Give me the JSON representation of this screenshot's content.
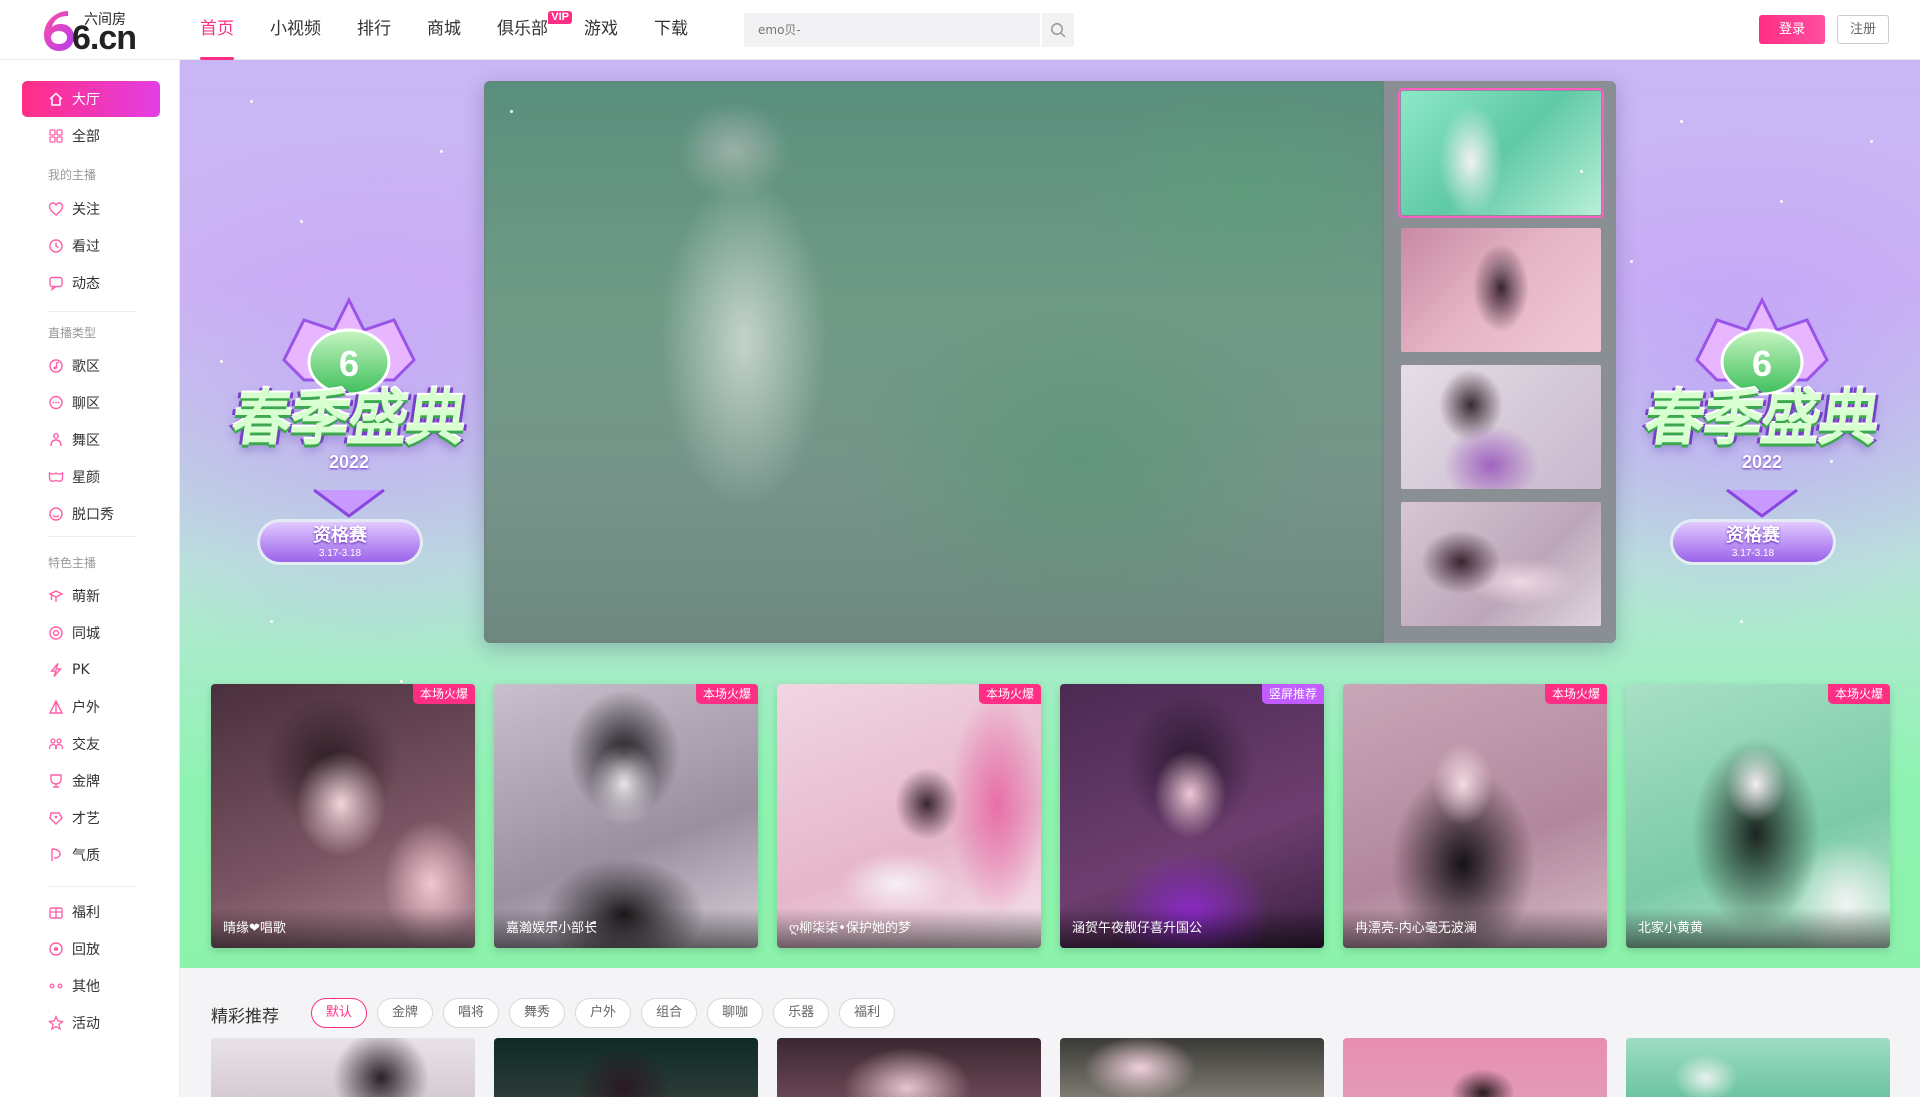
{
  "header": {
    "logo": {
      "brand": "6.cn",
      "cn_name": "六间房"
    },
    "nav": [
      {
        "label": "首页",
        "active": true
      },
      {
        "label": "小视频"
      },
      {
        "label": "排行"
      },
      {
        "label": "商城"
      },
      {
        "label": "俱乐部",
        "badge": "VIP"
      },
      {
        "label": "游戏"
      },
      {
        "label": "下载"
      }
    ],
    "search": {
      "placeholder": "emo贝-"
    },
    "login_label": "登录",
    "register_label": "注册"
  },
  "sidebar": {
    "top": [
      {
        "label": "大厅",
        "icon": "home-icon",
        "active": true
      },
      {
        "label": "全部",
        "icon": "grid-icon"
      }
    ],
    "my_anchors": {
      "title": "我的主播",
      "items": [
        {
          "label": "关注",
          "icon": "heart-icon"
        },
        {
          "label": "看过",
          "icon": "clock-icon"
        },
        {
          "label": "动态",
          "icon": "chat-icon"
        }
      ]
    },
    "live_types": {
      "title": "直播类型",
      "items": [
        {
          "label": "歌区",
          "icon": "music-icon"
        },
        {
          "label": "聊区",
          "icon": "bubble-icon"
        },
        {
          "label": "舞区",
          "icon": "dance-icon"
        },
        {
          "label": "星颜",
          "icon": "mask-icon"
        },
        {
          "label": "脱口秀",
          "icon": "mic-icon"
        }
      ]
    },
    "featured": {
      "title": "特色主播",
      "items": [
        {
          "label": "萌新",
          "icon": "sprout-icon"
        },
        {
          "label": "同城",
          "icon": "location-icon"
        },
        {
          "label": "PK",
          "icon": "lightning-icon"
        },
        {
          "label": "户外",
          "icon": "tent-icon"
        },
        {
          "label": "交友",
          "icon": "friends-icon"
        },
        {
          "label": "金牌",
          "icon": "medal-icon"
        },
        {
          "label": "才艺",
          "icon": "talent-icon"
        },
        {
          "label": "气质",
          "icon": "elegant-icon"
        }
      ]
    },
    "bottom": [
      {
        "label": "福利",
        "icon": "gift-icon"
      },
      {
        "label": "回放",
        "icon": "replay-icon"
      },
      {
        "label": "其他",
        "icon": "more-icon"
      },
      {
        "label": "活动",
        "icon": "star-icon"
      }
    ]
  },
  "banner": {
    "event_title": "春季盛典",
    "event_year": "2022",
    "stage_label": "资格赛",
    "stage_dates": "3.17-3.18",
    "hot_cards": [
      {
        "name": "晴缘❤唱歌",
        "tag": "本场火爆",
        "tag_type": "hot"
      },
      {
        "name": "嘉瀚娱乐ื小部长ื",
        "tag": "本场火爆",
        "tag_type": "hot"
      },
      {
        "name": "ღ柳柒柒•保护她的梦",
        "tag": "本场火爆",
        "tag_type": "hot"
      },
      {
        "name": "涵贺午夜靓仔喜升国公",
        "tag": "竖屏推荐",
        "tag_type": "vert"
      },
      {
        "name": "冉漂亮-内心毫无波澜",
        "tag": "本场火爆",
        "tag_type": "hot"
      },
      {
        "name": "北家小黄黄",
        "tag": "本场火爆",
        "tag_type": "hot"
      }
    ]
  },
  "recommend": {
    "title": "精彩推荐",
    "filters": [
      {
        "label": "默认",
        "active": true
      },
      {
        "label": "金牌"
      },
      {
        "label": "唱将"
      },
      {
        "label": "舞秀"
      },
      {
        "label": "户外"
      },
      {
        "label": "组合"
      },
      {
        "label": "聊咖"
      },
      {
        "label": "乐器"
      },
      {
        "label": "福利"
      }
    ]
  },
  "colors": {
    "accent": "#ff2e85",
    "sidebar_active_end": "#e33ee4",
    "vertical_tag": "#c35cff"
  }
}
